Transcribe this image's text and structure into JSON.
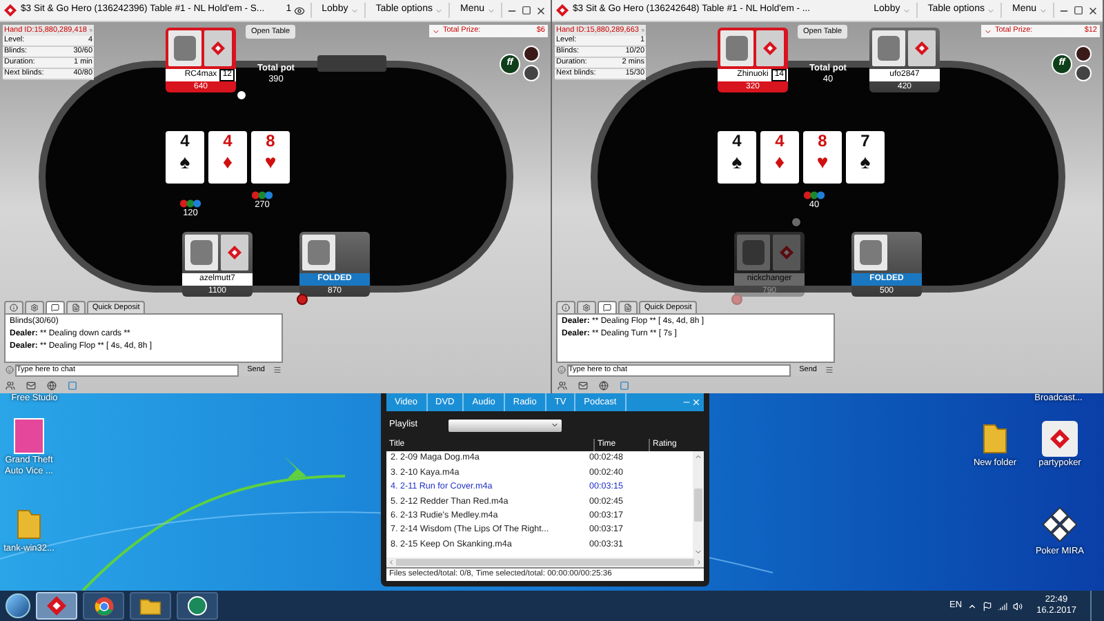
{
  "windows": [
    {
      "title": "$3 Sit & Go Hero (136242396) Table #1 - NL Hold'em - S...",
      "observers": "1",
      "menus": [
        "Lobby",
        "Table options",
        "Menu"
      ],
      "hand_id": "Hand ID:15,880,289,418",
      "levels": [
        {
          "label": "Level:",
          "value": "4"
        },
        {
          "label": "Blinds:",
          "value": "30/60"
        },
        {
          "label": "Duration:",
          "value": "1 min"
        },
        {
          "label": "Next blinds:",
          "value": "40/80"
        }
      ],
      "open_table": "Open Table",
      "prize_label": "Total Prize:",
      "prize": "$6",
      "ff_label": "ff",
      "pot_label": "Total pot",
      "pot": "390",
      "cards": [
        {
          "rank": "4",
          "suit": "♠",
          "color": "#111111"
        },
        {
          "rank": "4",
          "suit": "♦",
          "color": "#d01010"
        },
        {
          "rank": "8",
          "suit": "♥",
          "color": "#d01010"
        }
      ],
      "bets": [
        {
          "amount": "120"
        },
        {
          "amount": "270"
        }
      ],
      "seats": [
        {
          "name": "RC4max",
          "badge": "12",
          "stack": "640",
          "active": true,
          "folded": false,
          "sitting_out": false,
          "dealer": true,
          "alert": false
        },
        {
          "name": "azelmutt7",
          "stack": "1100",
          "active": false,
          "folded": false,
          "sitting_out": false,
          "dealer": false,
          "alert": false
        },
        {
          "label": "FOLDED",
          "stack": "870",
          "active": false,
          "folded": true,
          "sitting_out": false,
          "dealer": false,
          "alert": true
        }
      ],
      "chat_tabs": [
        {
          "kind": "info",
          "selected": false
        },
        {
          "kind": "settings",
          "selected": false
        },
        {
          "kind": "chat",
          "selected": true
        },
        {
          "kind": "notes",
          "selected": false
        },
        {
          "kind": "text",
          "label": "Quick Deposit",
          "selected": false
        }
      ],
      "chat": [
        {
          "text": "Blinds(30/60)"
        },
        {
          "speaker": "Dealer:",
          "text": "** Dealing down cards **"
        },
        {
          "speaker": "Dealer:",
          "text": "** Dealing Flop ** [ 4s, 4d, 8h ]"
        }
      ],
      "chat_placeholder": "Type here to chat",
      "send": "Send"
    },
    {
      "title": "$3 Sit & Go Hero (136242648) Table #1 - NL Hold'em - ...",
      "menus": [
        "Lobby",
        "Table options",
        "Menu"
      ],
      "hand_id": "Hand ID:15,880,289,663",
      "levels": [
        {
          "label": "Level:",
          "value": "1"
        },
        {
          "label": "Blinds:",
          "value": "10/20"
        },
        {
          "label": "Duration:",
          "value": "2 mins"
        },
        {
          "label": "Next blinds:",
          "value": "15/30"
        }
      ],
      "open_table": "Open Table",
      "prize_label": "Total Prize:",
      "prize": "$12",
      "ff_label": "ff",
      "pot_label": "Total pot",
      "pot": "40",
      "cards": [
        {
          "rank": "4",
          "suit": "♠",
          "color": "#111111"
        },
        {
          "rank": "4",
          "suit": "♦",
          "color": "#d01010"
        },
        {
          "rank": "8",
          "suit": "♥",
          "color": "#d01010"
        },
        {
          "rank": "7",
          "suit": "♠",
          "color": "#111111"
        }
      ],
      "bets": [
        {
          "amount": "40"
        }
      ],
      "seats": [
        {
          "name": "Zhinuoki",
          "badge": "14",
          "stack": "320",
          "active": true,
          "folded": false,
          "sitting_out": false,
          "dealer": false,
          "alert": false
        },
        {
          "name": "ufo2847",
          "stack": "420",
          "active": false,
          "folded": false,
          "sitting_out": false,
          "dealer": false,
          "alert": false
        },
        {
          "name": "nickchanger",
          "stack": "790",
          "active": false,
          "folded": false,
          "sitting_out": true,
          "dealer": true,
          "alert": true
        },
        {
          "label": "FOLDED",
          "stack": "500",
          "active": false,
          "folded": true,
          "sitting_out": false,
          "dealer": false,
          "alert": false
        }
      ],
      "chat_tabs": [
        {
          "kind": "info",
          "selected": false
        },
        {
          "kind": "settings",
          "selected": false
        },
        {
          "kind": "chat",
          "selected": true
        },
        {
          "kind": "notes",
          "selected": false
        },
        {
          "kind": "text",
          "label": "Quick Deposit",
          "selected": false
        }
      ],
      "chat": [
        {
          "speaker": "Dealer:",
          "text": "** Dealing Flop ** [ 4s, 4d, 8h ]"
        },
        {
          "speaker": "Dealer:",
          "text": "** Dealing Turn ** [ 7s ]"
        }
      ],
      "chat_placeholder": "Type here to chat",
      "send": "Send"
    }
  ],
  "desktop_icons": [
    {
      "kind": "label-only",
      "label": "Free Studio"
    },
    {
      "kind": "label-only",
      "label": "Broadcast..."
    },
    {
      "kind": "image",
      "label": "Grand Theft Auto Vice ..."
    },
    {
      "kind": "folder",
      "label": "New folder"
    },
    {
      "kind": "app",
      "label": "partypoker"
    },
    {
      "kind": "folder",
      "label": "tank-win32..."
    },
    {
      "kind": "grid-app",
      "label": "Poker MIRA"
    }
  ],
  "media_player": {
    "tabs": [
      "Video",
      "DVD",
      "Audio",
      "Radio",
      "TV",
      "Podcast"
    ],
    "playlist_label": "Playlist",
    "columns": [
      "Title",
      "Time",
      "Rating"
    ],
    "rows": [
      {
        "title": "2. 2-09 Maga Dog.m4a",
        "time": "00:02:48",
        "selected": false
      },
      {
        "title": "3. 2-10 Kaya.m4a",
        "time": "00:02:40",
        "selected": false
      },
      {
        "title": "4. 2-11 Run for Cover.m4a",
        "time": "00:03:15",
        "selected": true
      },
      {
        "title": "5. 2-12 Redder Than Red.m4a",
        "time": "00:02:45",
        "selected": false
      },
      {
        "title": "6. 2-13 Rudie's Medley.m4a",
        "time": "00:03:17",
        "selected": false
      },
      {
        "title": "7. 2-14 Wisdom (The Lips Of The Right...",
        "time": "00:03:17",
        "selected": false
      },
      {
        "title": "8. 2-15 Keep On Skanking.m4a",
        "time": "00:03:31",
        "selected": false
      }
    ],
    "status_files": "Files selected/total: 0/8,",
    "status_time": "Time selected/total: 00:00:00/00:25:36"
  },
  "taskbar": {
    "apps": [
      {
        "kind": "poker",
        "active": true
      },
      {
        "kind": "browser",
        "active": false
      },
      {
        "kind": "folder",
        "active": false
      },
      {
        "kind": "media",
        "active": false
      }
    ],
    "language": "EN",
    "time": "22:49",
    "date": "16.2.2017"
  }
}
